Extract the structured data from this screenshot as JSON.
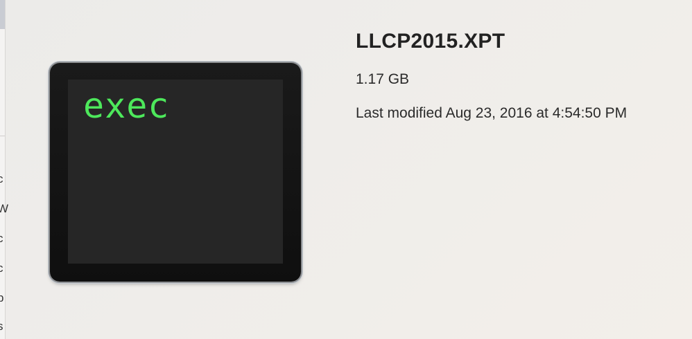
{
  "background_window": {
    "fragments": [
      "c",
      "W",
      "c",
      "c",
      "p",
      "s"
    ]
  },
  "file": {
    "icon_text": "exec",
    "icon_name": "terminal-exec-icon",
    "name": "LLCP2015.XPT",
    "size": "1.17 GB",
    "modified": "Last modified Aug 23, 2016 at 4:54:50 PM"
  },
  "colors": {
    "terminal_text": "#4de85b",
    "terminal_bg": "#262626",
    "icon_frame": "#111111"
  }
}
